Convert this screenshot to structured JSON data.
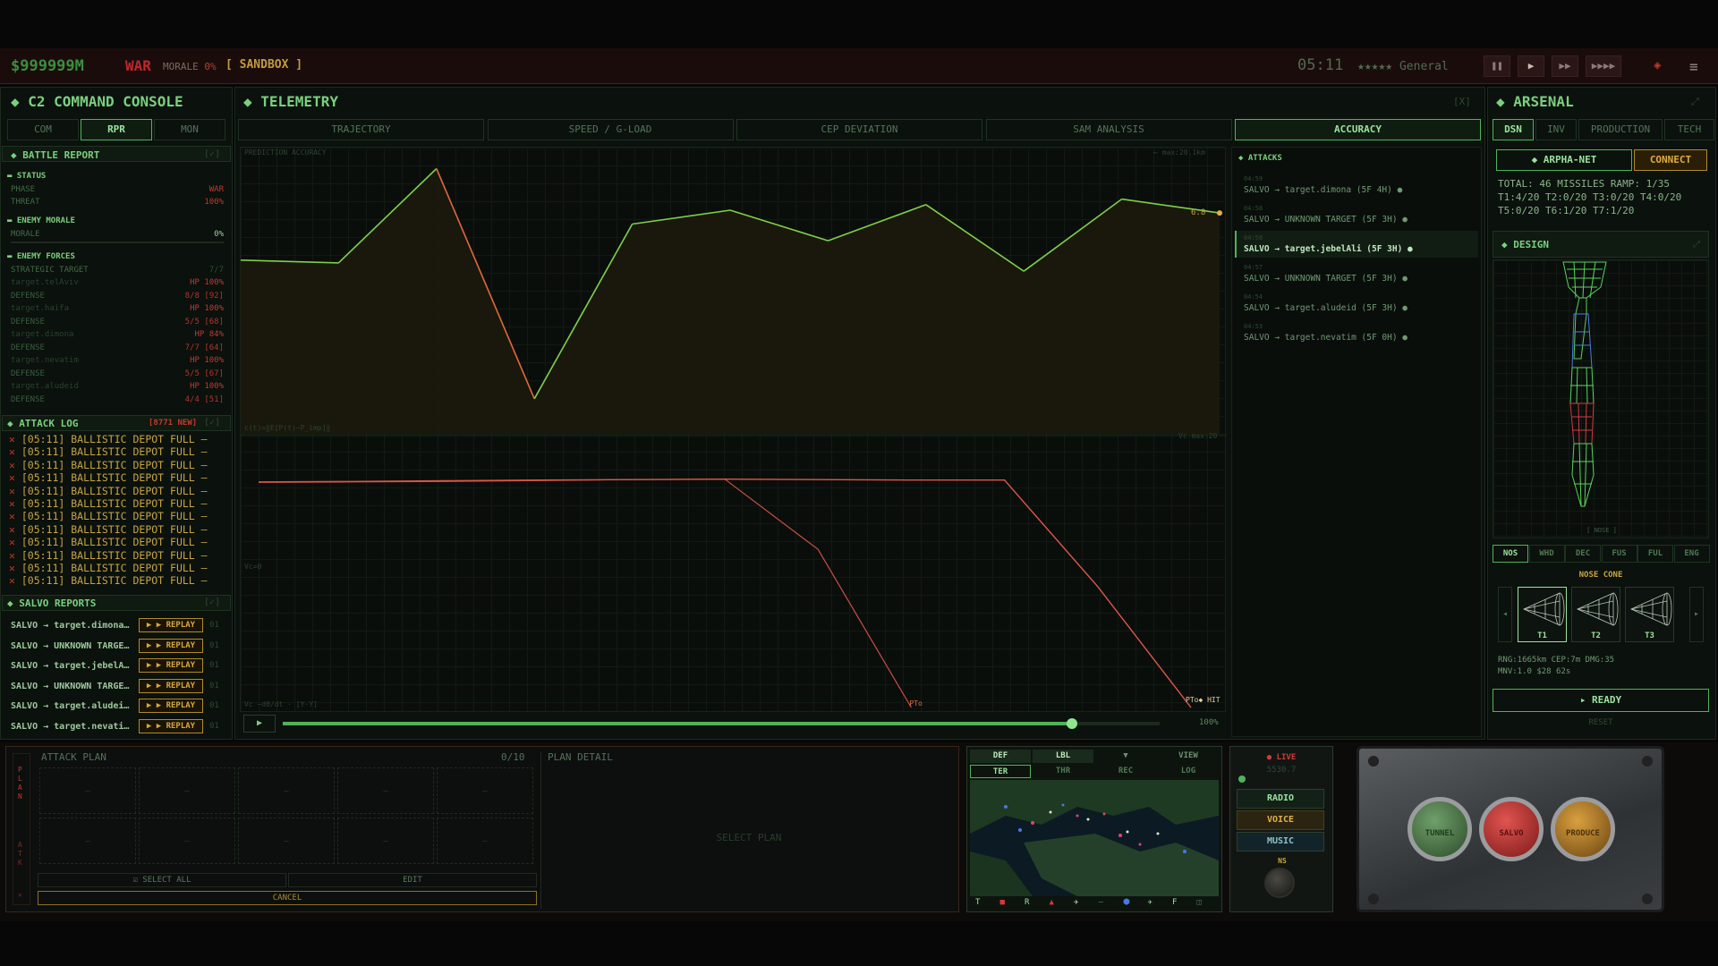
{
  "topbar": {
    "money": "$999999M",
    "phase": "WAR",
    "morale_label": "MORALE",
    "morale_value": "0%",
    "mode": "[ SANDBOX ]",
    "clock": "05:11",
    "rank": "★★★★★ General",
    "controls": [
      "❚❚",
      "▶",
      "▶▶",
      "▶▶▶▶"
    ]
  },
  "console": {
    "title": "C2 COMMAND CONSOLE",
    "tabs": [
      "COM",
      "RPR",
      "MON"
    ],
    "active_tab": "RPR",
    "battle_report": {
      "title": "BATTLE REPORT",
      "check": "[✓]",
      "status_header": "STATUS",
      "phase_label": "PHASE",
      "phase_value": "WAR",
      "threat_label": "THREAT",
      "threat_value": "100%",
      "morale_header": "ENEMY MORALE",
      "morale_label": "MORALE",
      "morale_value": "0%",
      "forces_header": "ENEMY FORCES",
      "strategic_label": "STRATEGIC TARGET",
      "strategic_value": "7/7",
      "rows": [
        {
          "l": "target.telAviv",
          "v": "HP 100%"
        },
        {
          "l": "DEFENSE",
          "v": "8/8 [92]"
        },
        {
          "l": "target.haifa",
          "v": "HP 100%"
        },
        {
          "l": "DEFENSE",
          "v": "5/5 [68]"
        },
        {
          "l": "target.dimona",
          "v": "HP 84%"
        },
        {
          "l": "DEFENSE",
          "v": "7/7 [64]"
        },
        {
          "l": "target.nevatim",
          "v": "HP 100%"
        },
        {
          "l": "DEFENSE",
          "v": "5/5 [67]"
        },
        {
          "l": "target.aludeid",
          "v": "HP 100%"
        },
        {
          "l": "DEFENSE",
          "v": "4/4 [51]"
        }
      ]
    },
    "attack_log": {
      "title": "ATTACK LOG",
      "badge": "[8771 NEW]",
      "check": "[✓]",
      "lines": [
        "[05:11] BALLISTIC DEPOT FULL —",
        "[05:11] BALLISTIC DEPOT FULL —",
        "[05:11] BALLISTIC DEPOT FULL —",
        "[05:11] BALLISTIC DEPOT FULL —",
        "[05:11] BALLISTIC DEPOT FULL —",
        "[05:11] BALLISTIC DEPOT FULL —",
        "[05:11] BALLISTIC DEPOT FULL —",
        "[05:11] BALLISTIC DEPOT FULL —",
        "[05:11] BALLISTIC DEPOT FULL —",
        "[05:11] BALLISTIC DEPOT FULL —",
        "[05:11] BALLISTIC DEPOT FULL —",
        "[05:11] BALLISTIC DEPOT FULL —"
      ]
    },
    "salvo_reports": {
      "title": "SALVO REPORTS",
      "check": "[✓]",
      "replay_label": "▶ ▶ REPLAY",
      "items": [
        {
          "name": "SALVO → target.dimona…",
          "n": "01"
        },
        {
          "name": "SALVO → UNKNOWN TARGE…",
          "n": "01"
        },
        {
          "name": "SALVO → target.jebelA…",
          "n": "01"
        },
        {
          "name": "SALVO → UNKNOWN TARGE…",
          "n": "01"
        },
        {
          "name": "SALVO → target.aludei…",
          "n": "01"
        },
        {
          "name": "SALVO → target.nevati…",
          "n": "01"
        }
      ]
    }
  },
  "telemetry": {
    "title": "TELEMETRY",
    "close": "[X]",
    "tabs": [
      "TRAJECTORY",
      "SPEED / G-LOAD",
      "CEP DEVIATION",
      "SAM ANALYSIS",
      "ACCURACY"
    ],
    "active_tab": "ACCURACY",
    "upper_caption": "PREDICTION ACCURACY",
    "upper_right_caption": "← max:20.1km",
    "formula": "c(t)=‖E[P(t)−P_imp]‖",
    "lower_right_caption": "Vc max:20",
    "zero_caption": "Vc=0",
    "lower_left_caption": "Vc −dθ/dt · [Y·Y]",
    "endpoint_value": "6.8",
    "pt_label_1": "PTo",
    "pt_label_2": "PTo◆ HIT",
    "progress": 0.9,
    "progress_label": "100%",
    "play": "▶",
    "attacks": {
      "title": "ATTACKS",
      "items": [
        {
          "t": "04:59",
          "name": "SALVO → target.dimona (5F 4H) ●"
        },
        {
          "t": "04:58",
          "name": "SALVO → UNKNOWN TARGET (5F 3H) ●"
        },
        {
          "t": "04:58",
          "name": "SALVO → target.jebelAli (5F 3H) ●"
        },
        {
          "t": "04:57",
          "name": "SALVO → UNKNOWN TARGET (5F 3H) ●"
        },
        {
          "t": "04:54",
          "name": "SALVO → target.aludeid (5F 3H) ●"
        },
        {
          "t": "04:53",
          "name": "SALVO → target.nevatim (5F 0H) ●"
        }
      ]
    }
  },
  "chart_data": {
    "type": "line",
    "series": [
      {
        "values": [
          6.2,
          6.1,
          9.5,
          1.2,
          7.5,
          8.0,
          6.9,
          8.2,
          5.8,
          8.4,
          7.9
        ]
      },
      {
        "values": [
          9.7,
          9.72,
          9.75,
          9.78,
          9.8,
          9.82,
          9.8,
          9.78,
          9.78,
          5.2,
          0
        ]
      }
    ]
  },
  "arsenal": {
    "title": "ARSENAL",
    "tabs": [
      "DSN",
      "INV",
      "PRODUCTION",
      "TECH"
    ],
    "active_tab": "DSN",
    "network": "◆ ARPHA-NET",
    "connect": "CONNECT",
    "stats": [
      "TOTAL: 46 MISSILES RAMP: 1/35",
      "T1:4/20 T2:0/20 T3:0/20 T4:0/20",
      "T5:0/20 T6:1/20 T7:1/20"
    ],
    "design_title": "DESIGN",
    "nose_caption": "[ NOSE ]",
    "parts": [
      "NOS",
      "WHD",
      "DEC",
      "FUS",
      "FUL",
      "ENG"
    ],
    "active_part": "NOS",
    "section_title": "NOSE CONE",
    "tiers": [
      "T1",
      "T2",
      "T3"
    ],
    "spec_line1": "RNG:1665km CEP:7m DMG:35",
    "spec_line2": "MNV:1.0 $28 62s",
    "ready": "▸ READY",
    "reset": "RESET"
  },
  "bottom": {
    "plan_vertical": "PLAN",
    "atk_vertical": "ATK",
    "attack_plan_title": "ATTACK PLAN",
    "plan_count": "0/10",
    "plan_detail_title": "PLAN DETAIL",
    "empty_cell": "—",
    "select_plan": "SELECT PLAN",
    "select_all": "☑ SELECT ALL",
    "edit": "EDIT",
    "cancel": "CANCEL",
    "map_tabs_row1": [
      "DEF",
      "LBL",
      "▼",
      "VIEW"
    ],
    "map_tabs_row2": [
      "TER",
      "THR",
      "REC",
      "LOG"
    ],
    "map_footer": [
      "T",
      "■",
      "R",
      "▲",
      "✈",
      "—",
      "⬢",
      "✈",
      "F",
      "◫"
    ],
    "live": "● LIVE",
    "freq": "5530.7",
    "radio": "RADIO",
    "voice": "VOICE",
    "music": "MUSIC",
    "knob": "NS",
    "big_buttons": [
      "TUNNEL",
      "SALVO",
      "PRODUCE"
    ]
  },
  "colors": {
    "accent": "#4fb35a",
    "danger": "#c3262a",
    "amber": "#c8a545",
    "bg": "#070707"
  }
}
